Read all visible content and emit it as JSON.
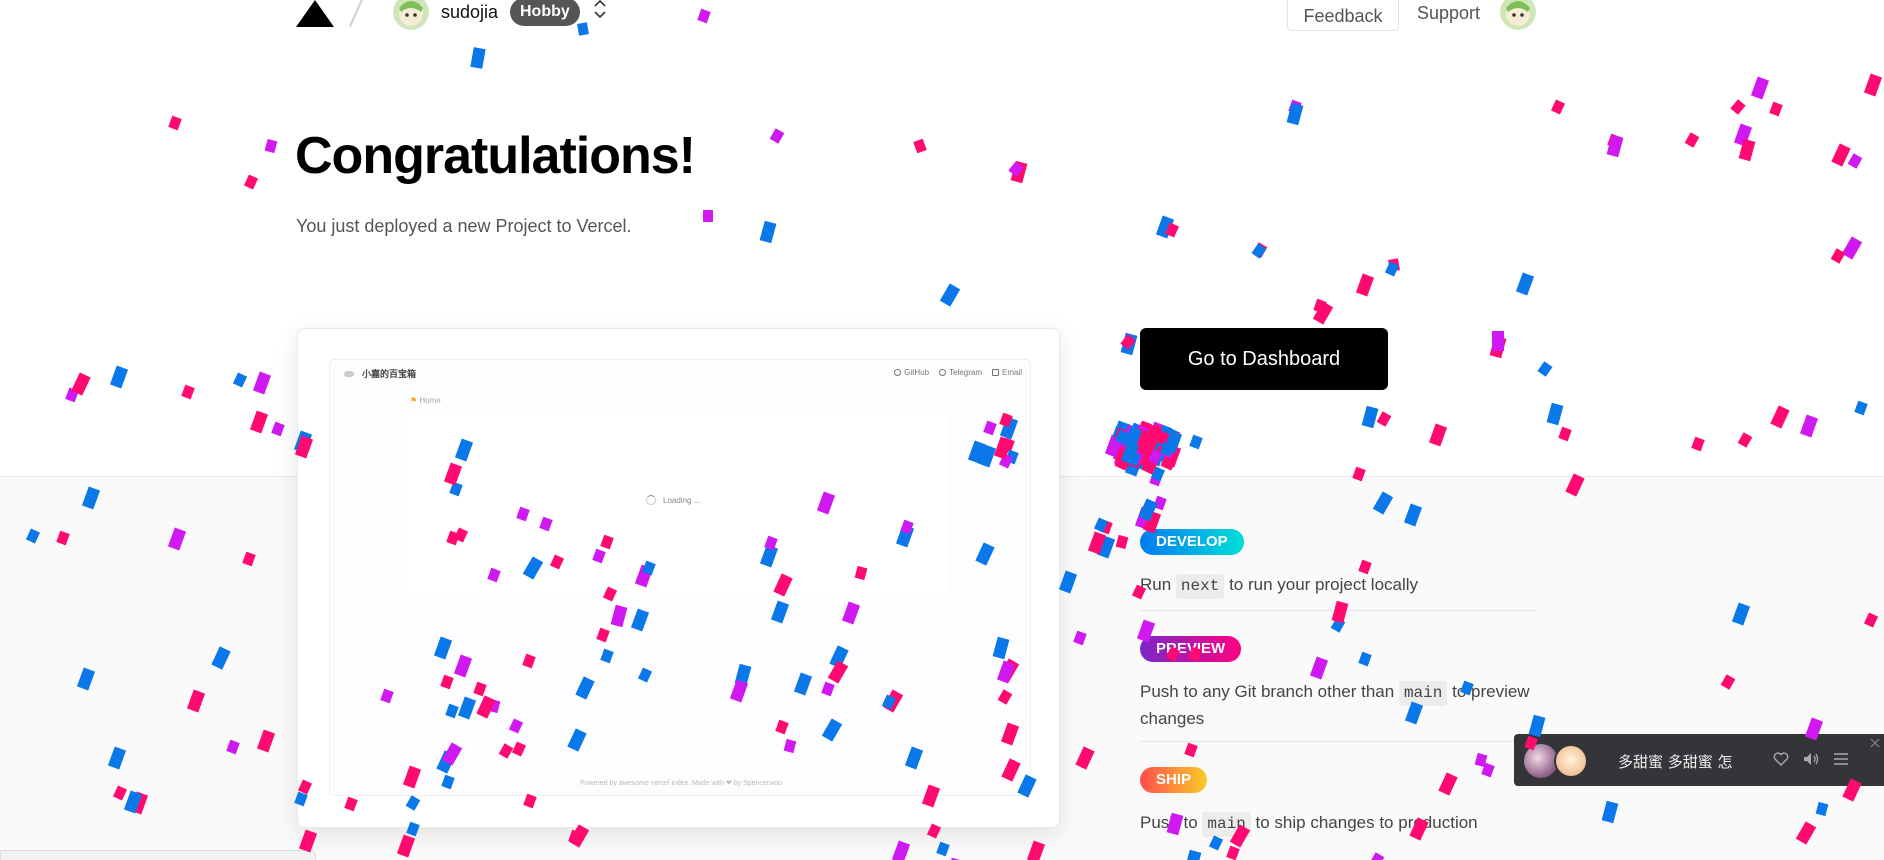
{
  "header": {
    "logo_icon": "vercel-triangle-icon",
    "username": "sudojia",
    "plan_badge": "Hobby",
    "feedback_label": "Feedback",
    "support_label": "Support"
  },
  "hero": {
    "title": "Congratulations!",
    "subtitle": "You just deployed a new Project to Vercel."
  },
  "preview": {
    "site_title": "小嘉的百宝箱",
    "nav": [
      "GitHub",
      "Telegram",
      "Email"
    ],
    "breadcrumb": "Home",
    "loading": "Loading ...",
    "footer": "Powered by awesome vercel index. Made with ❤ by Spencerwoo"
  },
  "dashboard_button": "Go to Dashboard",
  "steps": [
    {
      "badge": "DEVELOP",
      "pre": "Run",
      "code": "next",
      "post": "to run your project locally"
    },
    {
      "badge": "PREVIEW",
      "pre": "Push to any Git branch other than",
      "code": "main",
      "post": "to preview changes"
    },
    {
      "badge": "SHIP",
      "pre": "Push to",
      "code": "main",
      "post": "to ship changes to production"
    }
  ],
  "music_player": {
    "song": "多甜蜜 多甜蜜 怎能忘",
    "controls": [
      "heart-icon",
      "volume-icon",
      "playlist-icon"
    ]
  },
  "colors": {
    "confetti": [
      "#ff0a70",
      "#d018f0",
      "#0a78e8"
    ],
    "develop": [
      "#007cf0",
      "#00dfd8"
    ],
    "preview": [
      "#7928ca",
      "#ff0080"
    ],
    "ship": [
      "#ff4d4d",
      "#f9cb28"
    ]
  }
}
